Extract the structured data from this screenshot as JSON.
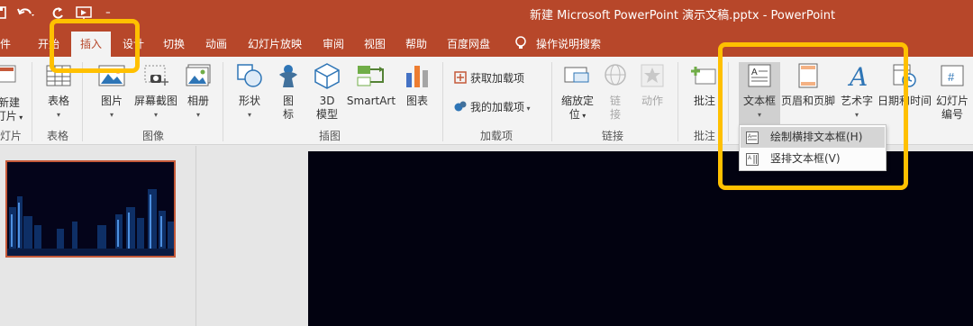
{
  "window": {
    "title": "新建 Microsoft PowerPoint 演示文稿.pptx  -  PowerPoint"
  },
  "tabs": [
    {
      "label": "件"
    },
    {
      "label": "开始"
    },
    {
      "label": "插入"
    },
    {
      "label": "设计"
    },
    {
      "label": "切换"
    },
    {
      "label": "动画"
    },
    {
      "label": "幻灯片放映"
    },
    {
      "label": "审阅"
    },
    {
      "label": "视图"
    },
    {
      "label": "帮助"
    },
    {
      "label": "百度网盘"
    }
  ],
  "active_tab": "插入",
  "tell_me": "操作说明搜索",
  "ribbon": {
    "new_slide": {
      "line1": "新建",
      "line2": "灯片"
    },
    "table": "表格",
    "picture": "图片",
    "screenshot": "屏幕截图",
    "album": "相册",
    "shape": "形状",
    "icon": {
      "line1": "图",
      "line2": "标"
    },
    "model3d": {
      "line1": "3D",
      "line2": "模型"
    },
    "smartart": "SmartArt",
    "chart": "图表",
    "get_addins": "获取加载项",
    "my_addins": "我的加载项",
    "zoom": {
      "line1": "缩放定",
      "line2": "位"
    },
    "link": {
      "line1": "链",
      "line2": "接"
    },
    "action": "动作",
    "comment": "批注",
    "textbox": "文本框",
    "header_footer": "页眉和页脚",
    "wordart": "艺术字",
    "datetime": "日期和时间",
    "slide_number": {
      "line1": "幻灯片",
      "line2": "编号"
    }
  },
  "groups": {
    "slides": "灯片",
    "tables": "表格",
    "images": "图像",
    "illustrations": "插图",
    "addins": "加载项",
    "links": "链接",
    "comments": "批注"
  },
  "textbox_menu": [
    {
      "label": "绘制横排文本框(H)",
      "highlighted": true
    },
    {
      "label": "竖排文本框(V)",
      "highlighted": false
    }
  ],
  "colors": {
    "accent": "#b7472a",
    "highlight": "#ffc000",
    "ribbon_bg": "#f3f3f3"
  }
}
